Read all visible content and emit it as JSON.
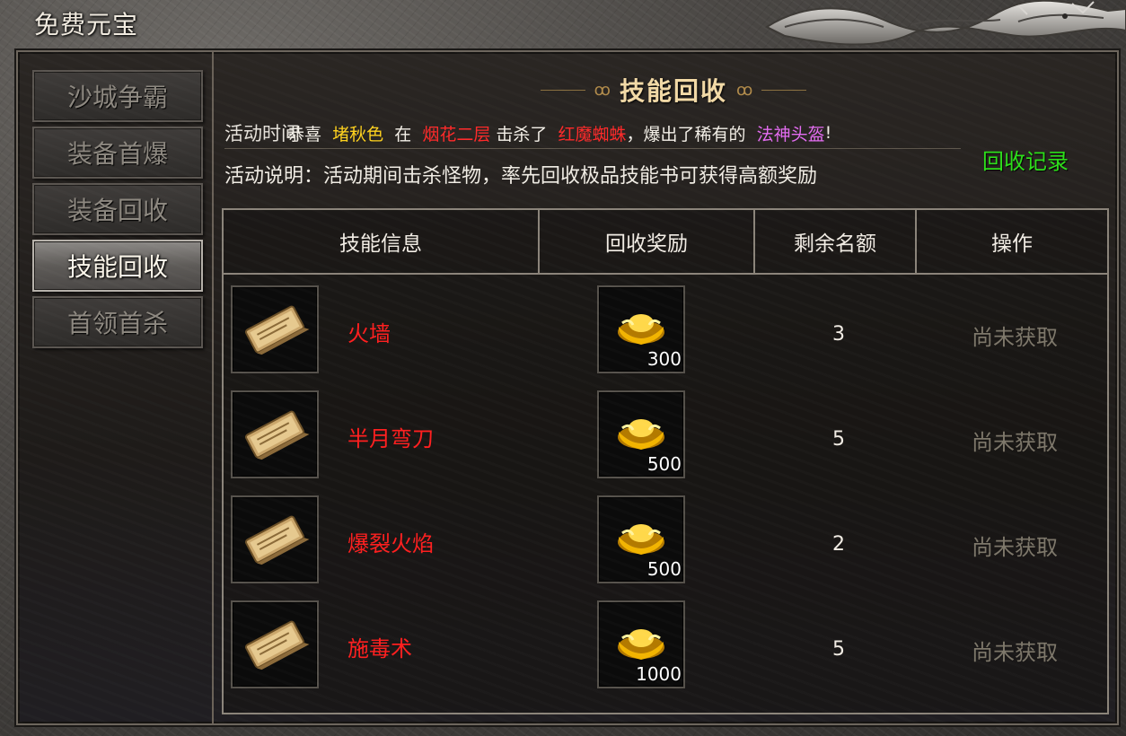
{
  "window": {
    "title": "免费元宝"
  },
  "sidebar": {
    "items": [
      {
        "label": "沙城争霸",
        "active": false
      },
      {
        "label": "装备首爆",
        "active": false
      },
      {
        "label": "装备回收",
        "active": false
      },
      {
        "label": "技能回收",
        "active": true
      },
      {
        "label": "首领首杀",
        "active": false
      }
    ]
  },
  "heading": {
    "title": "技能回收"
  },
  "info": {
    "time_prefix": "活动时间",
    "broadcast": {
      "p1": "恭喜",
      "player": "堵秋色",
      "p2": "在",
      "map": "烟花二层",
      "p3": "击杀了",
      "monster": "红魔蜘蛛",
      "p4": "，爆出了稀有的",
      "item": "法神头盔",
      "p5": "!"
    },
    "description": "活动说明：活动期间击杀怪物，率先回收极品技能书可获得高额奖励",
    "record_link": "回收记录"
  },
  "table": {
    "headers": [
      "技能信息",
      "回收奖励",
      "剩余名额",
      "操作"
    ],
    "rows": [
      {
        "skill": "火墙",
        "reward": "300",
        "remaining": "3",
        "action": "尚未获取"
      },
      {
        "skill": "半月弯刀",
        "reward": "500",
        "remaining": "5",
        "action": "尚未获取"
      },
      {
        "skill": "爆裂火焰",
        "reward": "500",
        "remaining": "2",
        "action": "尚未获取"
      },
      {
        "skill": "施毒术",
        "reward": "1000",
        "remaining": "5",
        "action": "尚未获取"
      }
    ]
  },
  "colors": {
    "player": "#ffd21e",
    "map": "#ff2a2a",
    "item": "#e36cf0",
    "record": "#2dde1a",
    "skill_name": "#ff1f1f"
  },
  "icons": {
    "skill_book": "skill-book-icon",
    "reward": "gold-ingot-icon"
  }
}
